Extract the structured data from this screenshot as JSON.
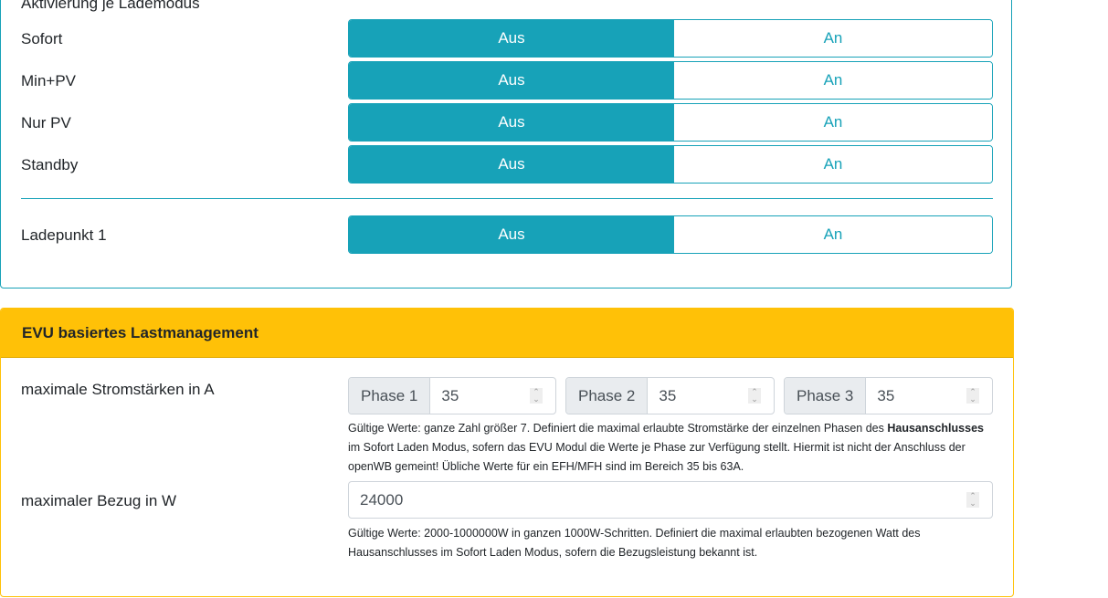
{
  "section1": {
    "heading": "Aktivierung je Lademodus",
    "rows": [
      {
        "label": "Sofort",
        "off": "Aus",
        "on": "An"
      },
      {
        "label": "Min+PV",
        "off": "Aus",
        "on": "An"
      },
      {
        "label": "Nur PV",
        "off": "Aus",
        "on": "An"
      },
      {
        "label": "Standby",
        "off": "Aus",
        "on": "An"
      }
    ],
    "ladepunkt": {
      "label": "Ladepunkt 1",
      "off": "Aus",
      "on": "An"
    }
  },
  "evu": {
    "title": "EVU basiertes Lastmanagement",
    "strom_label": "maximale Stromstärken in A",
    "phases": [
      {
        "label": "Phase 1",
        "value": "35"
      },
      {
        "label": "Phase 2",
        "value": "35"
      },
      {
        "label": "Phase 3",
        "value": "35"
      }
    ],
    "strom_help_1": "Gültige Werte: ganze Zahl größer 7. Definiert die maximal erlaubte Stromstärke der einzelnen Phasen des",
    "strom_help_bold": "Hausanschlusses",
    "strom_help_2": " im Sofort Laden Modus, sofern das EVU Modul die Werte je Phase zur Verfügung stellt. Hiermit ist nicht der Anschluss der openWB gemeint! Übliche Werte für ein EFH/MFH sind im Bereich 35 bis 63A.",
    "bezug_label": "maximaler Bezug in W",
    "bezug_value": "24000",
    "bezug_help": "Gültige Werte: 2000-1000000W in ganzen 1000W-Schritten. Definiert die maximal erlaubten bezogenen Watt des Hausanschlusses im Sofort Laden Modus, sofern die Bezugsleistung bekannt ist."
  }
}
